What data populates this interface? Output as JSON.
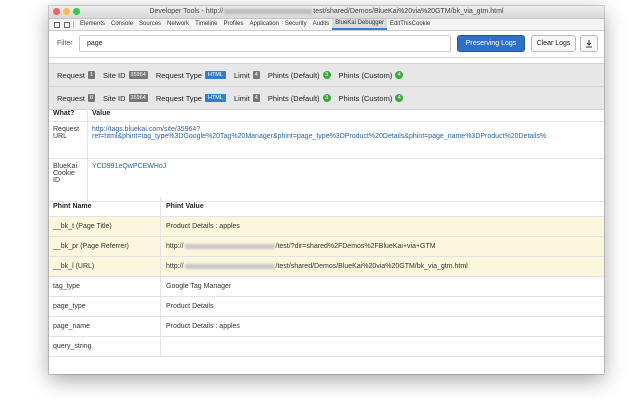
{
  "window": {
    "title_prefix": "Developer Tools - http://",
    "title_suffix": "test/shared/Demos/BlueKai%20via%20GTM/bk_via_gtm.html"
  },
  "devtools_tabs": [
    "Elements",
    "Console",
    "Sources",
    "Network",
    "Timeline",
    "Profiles",
    "Application",
    "Security",
    "Audits",
    "BlueKai Debugger",
    "EditThisCookie"
  ],
  "active_tab_index": 9,
  "toolbar": {
    "filter_label": "Filter",
    "filter_value": "page",
    "preserving_label": "Preserving Logs",
    "clear_label": "Clear Logs",
    "download_icon": "download-icon"
  },
  "requests": [
    {
      "request_label": "Request",
      "request_num": "1",
      "site_label": "Site ID",
      "site_id": "35964",
      "type_label": "Request Type",
      "type": "HTML",
      "limit_label": "Limit",
      "limit": "4",
      "phints_default_label": "Phints (Default)",
      "phints_default": "3",
      "phints_custom_label": "Phints (Custom)",
      "phints_custom": "4"
    },
    {
      "request_label": "Request",
      "request_num": "8",
      "site_label": "Site ID",
      "site_id": "35964",
      "type_label": "Request Type",
      "type": "HTML",
      "limit_label": "Limit",
      "limit": "4",
      "phints_default_label": "Phints (Default)",
      "phints_default": "3",
      "phints_custom_label": "Phints (Custom)",
      "phints_custom": "4"
    }
  ],
  "info": {
    "header": {
      "what": "What?",
      "value": "Value"
    },
    "request_url": {
      "label_1": "Request",
      "label_2": "URL",
      "value_1": "http://tags.bluekai.com/site/35964?",
      "value_2": "ret=html&phint=tag_type%3DGoogle%20Tag%20Manager&phint=page_type%3DProduct%20Details&phint=page_name%3DProduct%20Details%"
    },
    "cookie": {
      "label_1": "BlueKai",
      "label_2": "Cookie",
      "label_3": "ID",
      "value": "YCD991eQwPCEWHoJ"
    }
  },
  "phints": {
    "header": {
      "name": "Phint Name",
      "value": "Phint Value"
    },
    "rows": [
      {
        "name": "__bk_t (Page Title)",
        "value": "Product Details : apples",
        "highlight": true
      },
      {
        "name": "__bk_pr (Page Referrer)",
        "value_prefix": "http://",
        "value_suffix": "/test/?dir=shared%2FDemos%2FBlueKai+via+GTM",
        "highlight": true
      },
      {
        "name": "__bk_l (URL)",
        "value_prefix": "http://",
        "value_suffix": "/test/shared/Demos/BlueKai%20via%20GTM/bk_via_gtm.html",
        "highlight": true
      },
      {
        "name": "tag_type",
        "value": "Google Tag Manager",
        "highlight": false
      },
      {
        "name": "page_type",
        "value": "Product Details",
        "highlight": false
      },
      {
        "name": "page_name",
        "value": "Product Details : apples",
        "highlight": false
      },
      {
        "name": "query_string",
        "value": "",
        "highlight": false
      }
    ]
  }
}
